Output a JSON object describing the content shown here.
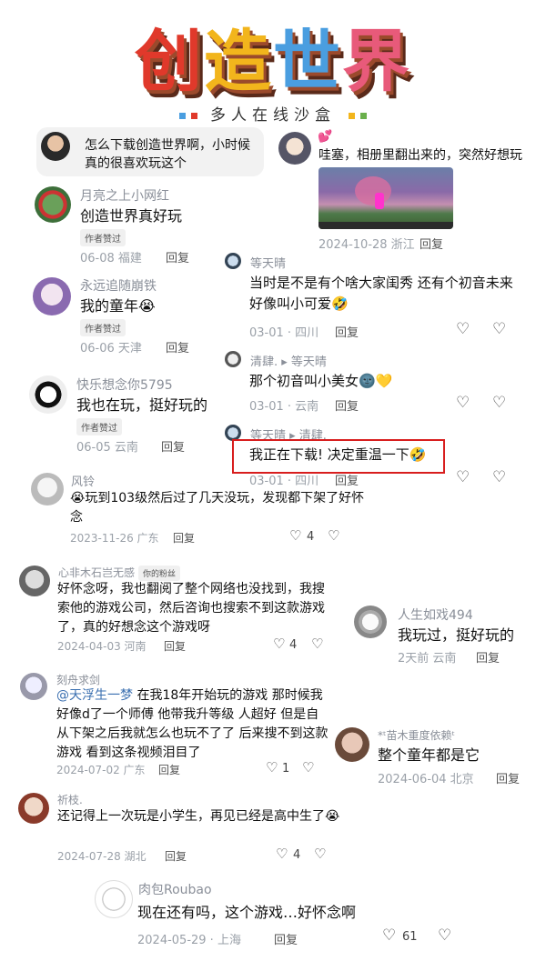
{
  "logo": {
    "title_chars": [
      "创",
      "造",
      "世",
      "界"
    ],
    "title_colors": [
      "#e0392b",
      "#f2b51c",
      "#4a9ee0",
      "#e85a7a"
    ],
    "subtitle": "多人在线沙盒"
  },
  "comments": {
    "c1": {
      "text": "怎么下载创造世界啊，小时候真的很喜欢玩这个"
    },
    "c2": {
      "text": "哇塞，相册里翻出来的，突然好想玩",
      "meta": "2024-10-28 浙江",
      "reply": "回复",
      "emoji": "💕"
    },
    "c3": {
      "name": "月亮之上小网红",
      "text": "创造世界真好玩",
      "tag": "作者赞过",
      "meta": "06-08 福建",
      "reply": "回复"
    },
    "c4": {
      "name": "永远追随崩铁",
      "text": "我的童年😭",
      "tag": "作者赞过",
      "meta": "06-06 天津",
      "reply": "回复"
    },
    "c5": {
      "name": "快乐想念你5795",
      "text": "我也在玩，挺好玩的",
      "tag": "作者赞过",
      "meta": "06-05 云南",
      "reply": "回复"
    },
    "r1": {
      "name": "等天晴",
      "text": "当时是不是有个啥大家闺秀 还有个初音未来好像叫小可爱🤣",
      "meta": "03-01 · 四川",
      "reply": "回复"
    },
    "r2": {
      "name": "清肆. ▸ 等天晴",
      "text": "那个初音叫小美女🌚💛",
      "meta": "03-01 · 云南",
      "reply": "回复"
    },
    "r3": {
      "name": "等天晴 ▸ 清肆.",
      "text": "我正在下载! 决定重温一下🤣",
      "meta": "03-01 · 四川",
      "reply": "回复"
    },
    "c6": {
      "name": "风铃",
      "text": "😭玩到103级然后过了几天没玩，发现都下架了好怀念",
      "meta": "2023-11-26 广东",
      "reply": "回复",
      "likes": "4"
    },
    "c7": {
      "name": "心非木石岂无感",
      "badge": "你的粉丝",
      "text": "好怀念呀，我也翻阅了整个网络也没找到，我搜索他的游戏公司，然后咨询也搜索不到这款游戏了，真的好想念这个游戏呀",
      "meta": "2024-04-03 河南",
      "reply": "回复",
      "likes": "4"
    },
    "c8": {
      "name": "人生如戏494",
      "text": "我玩过，挺好玩的",
      "meta": "2天前 云南",
      "reply": "回复"
    },
    "c9": {
      "name": "刻舟求剑",
      "mention": "@天浮生一梦",
      "text": " 在我18年开始玩的游戏 那时候我好像d了一个师傅 他带我升等级 人超好 但是自从下架之后我就怎么也玩不了了 后来搜不到这款游戏 看到这条视频泪目了",
      "meta": "2024-07-02 广东",
      "reply": "回复",
      "likes": "1"
    },
    "c10": {
      "name": "*ᵗ苗木重度依赖ᵗ",
      "text": "整个童年都是它",
      "meta": "2024-06-04 北京",
      "reply": "回复"
    },
    "c11": {
      "name": "祈枝.",
      "text": "还记得上一次玩是小学生，再见已经是高中生了😭",
      "meta": "2024-07-28 湖北",
      "reply": "回复",
      "likes": "4"
    },
    "c12": {
      "name": "肉包Roubao",
      "text": "现在还有吗，这个游戏…好怀念啊",
      "meta": "2024-05-29 · 上海",
      "reply": "回复",
      "likes": "61"
    }
  }
}
